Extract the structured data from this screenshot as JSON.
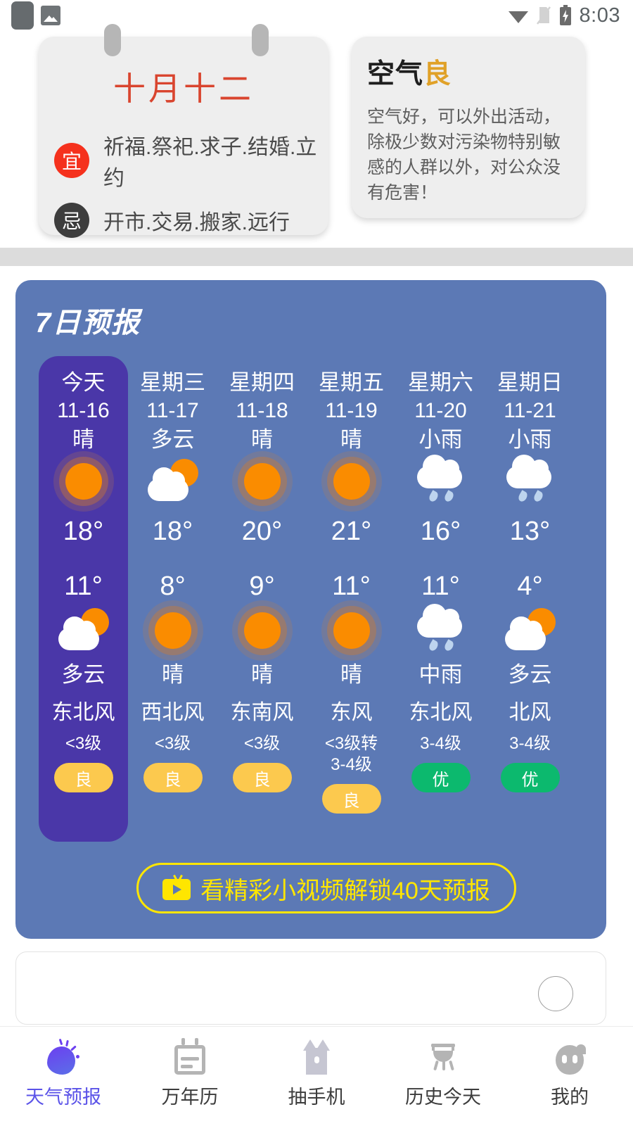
{
  "statusbar": {
    "time": "8:03",
    "icons": [
      "app-switcher-icon",
      "image-icon",
      "wifi-icon",
      "sim-off-icon",
      "battery-charging-icon"
    ]
  },
  "calendar_card": {
    "lunar_date": "十月十二",
    "good": {
      "badge": "宜",
      "items": "祈福.祭祀.求子.结婚.立约",
      "color": "#f5311d"
    },
    "bad": {
      "badge": "忌",
      "items": "开市.交易.搬家.远行",
      "color": "#3d3d3d"
    }
  },
  "air_card": {
    "title": "空气",
    "level": "良",
    "level_color": "#e0a128",
    "description": "空气好，可以外出活动，除极少数对污染物特别敏感的人群以外，对公众没有危害！"
  },
  "forecast": {
    "title": "7日预报",
    "card_color": "#5c79b5",
    "today_color": "#4a37a8",
    "video_button": {
      "label": "看精彩小视频解锁40天预报",
      "icon": "tv-play-icon",
      "color": "#ffe600"
    },
    "days": [
      {
        "week": "今天",
        "date": "11-16",
        "day_cond": "晴",
        "day_icon": "sun-icon",
        "high": "18°",
        "low": "11°",
        "night_cond": "多云",
        "night_icon": "partly-cloudy-icon",
        "wind": "东北风",
        "wind_level": "<3级",
        "aqi": "良",
        "aqi_class": "aqi-liang",
        "is_today": true
      },
      {
        "week": "星期三",
        "date": "11-17",
        "day_cond": "多云",
        "day_icon": "partly-cloudy-icon",
        "high": "18°",
        "low": "8°",
        "night_cond": "晴",
        "night_icon": "sun-icon",
        "wind": "西北风",
        "wind_level": "<3级",
        "aqi": "良",
        "aqi_class": "aqi-liang",
        "is_today": false
      },
      {
        "week": "星期四",
        "date": "11-18",
        "day_cond": "晴",
        "day_icon": "sun-icon",
        "high": "20°",
        "low": "9°",
        "night_cond": "晴",
        "night_icon": "sun-icon",
        "wind": "东南风",
        "wind_level": "<3级",
        "aqi": "良",
        "aqi_class": "aqi-liang",
        "is_today": false
      },
      {
        "week": "星期五",
        "date": "11-19",
        "day_cond": "晴",
        "day_icon": "sun-icon",
        "high": "21°",
        "low": "11°",
        "night_cond": "晴",
        "night_icon": "sun-icon",
        "wind": "东风",
        "wind_level": "<3级转\n3-4级",
        "aqi": "良",
        "aqi_class": "aqi-liang",
        "is_today": false
      },
      {
        "week": "星期六",
        "date": "11-20",
        "day_cond": "小雨",
        "day_icon": "rain-icon",
        "high": "16°",
        "low": "11°",
        "night_cond": "中雨",
        "night_icon": "rain-icon",
        "wind": "东北风",
        "wind_level": "3-4级",
        "aqi": "优",
        "aqi_class": "aqi-you",
        "is_today": false
      },
      {
        "week": "星期日",
        "date": "11-21",
        "day_cond": "小雨",
        "day_icon": "rain-icon",
        "high": "13°",
        "low": "4°",
        "night_cond": "多云",
        "night_icon": "partly-cloudy-icon",
        "wind": "北风",
        "wind_level": "3-4级",
        "aqi": "优",
        "aqi_class": "aqi-you",
        "is_today": false
      }
    ]
  },
  "bottom_nav": {
    "active_color": "#5b53e8",
    "items": [
      {
        "label": "天气预报",
        "icon": "weather-icon",
        "active": true
      },
      {
        "label": "万年历",
        "icon": "calendar-icon",
        "active": false
      },
      {
        "label": "抽手机",
        "icon": "gift-phone-icon",
        "active": false
      },
      {
        "label": "历史今天",
        "icon": "ding-cauldron-icon",
        "active": false
      },
      {
        "label": "我的",
        "icon": "profile-icon",
        "active": false
      }
    ]
  }
}
